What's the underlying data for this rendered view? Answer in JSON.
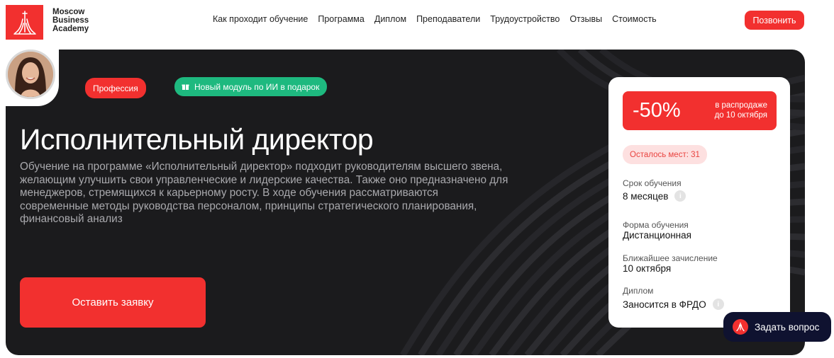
{
  "header": {
    "logo_lines": [
      "Moscow",
      "Business",
      "Academy"
    ],
    "nav": [
      "Как проходит обучение",
      "Программа",
      "Диплом",
      "Преподаватели",
      "Трудоустройство",
      "Отзывы",
      "Стоимость"
    ],
    "call_label": "Позвонить"
  },
  "hero": {
    "badge_profession": "Профессия",
    "badge_gift": "Новый модуль по ИИ в подарок",
    "title": "Исполнительный директор",
    "description": "Обучение на программе «Исполнительный директор» подходит руководителям высшего звена, желающим улучшить свои управленческие и лидерские качества. Также оно предназначено для менеджеров, стремящихся к карьерному росту. В ходе обучения рассматриваются современные методы руководства персоналом, принципы стратегического планирования, финансовый анализ",
    "apply_label": "Оставить заявку"
  },
  "card": {
    "discount": "-50%",
    "sale_line1": "в распродаже",
    "sale_line2": "до 10 октября",
    "seats": "Осталось мест: 31",
    "items": [
      {
        "label": "Срок обучения",
        "value": "8 месяцев"
      },
      {
        "label": "Форма обучения",
        "value": "Дистанционная"
      },
      {
        "label": "Ближайшее зачисление",
        "value": "10 октября"
      },
      {
        "label": "Диплом",
        "value": "Заносится в ФРДО"
      }
    ]
  },
  "ask_label": "Задать вопрос",
  "colors": {
    "accent": "#f2302f",
    "green": "#1eb97f",
    "dark": "#1b1b1d",
    "navy": "#0f1230"
  }
}
